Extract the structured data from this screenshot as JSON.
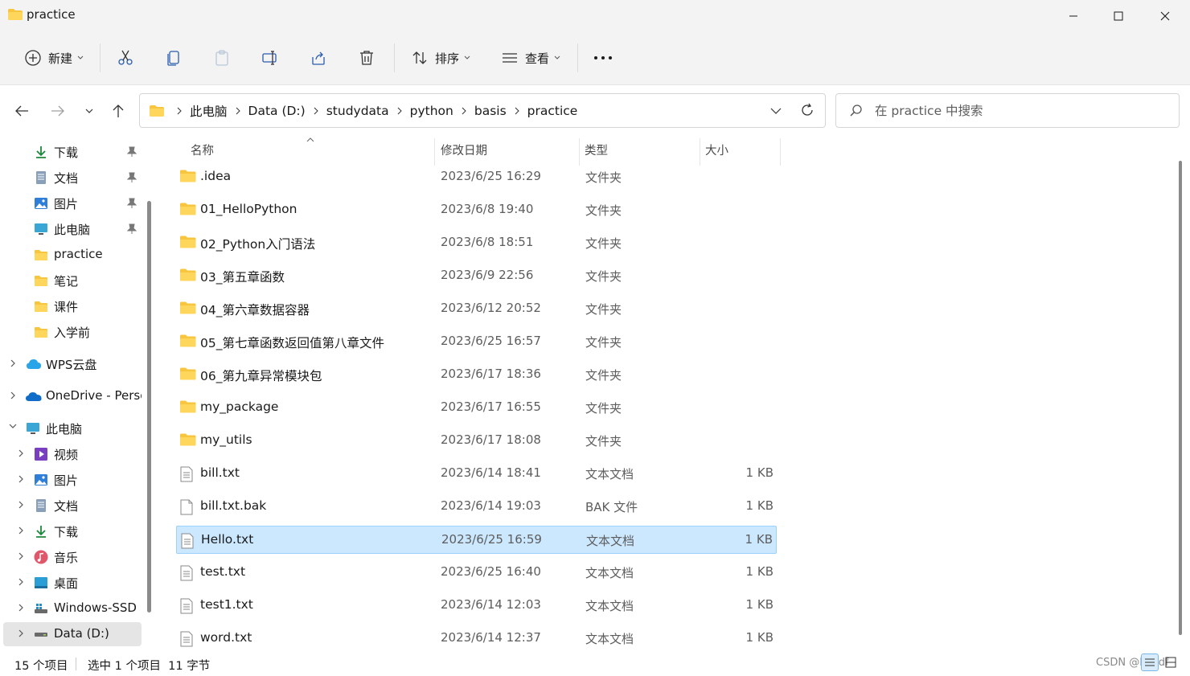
{
  "window": {
    "title": "practice"
  },
  "toolbar": {
    "new_label": "新建",
    "sort_label": "排序",
    "view_label": "查看"
  },
  "breadcrumb": [
    "此电脑",
    "Data (D:)",
    "studydata",
    "python",
    "basis",
    "practice"
  ],
  "search": {
    "placeholder": "在 practice 中搜索"
  },
  "sidebar": {
    "quick": [
      {
        "label": "下载",
        "icon": "download-icon",
        "pinned": true
      },
      {
        "label": "文档",
        "icon": "document-icon",
        "pinned": true
      },
      {
        "label": "图片",
        "icon": "picture-icon",
        "pinned": true
      },
      {
        "label": "此电脑",
        "icon": "computer-icon",
        "pinned": true
      },
      {
        "label": "practice",
        "icon": "folder-icon",
        "pinned": false
      },
      {
        "label": "笔记",
        "icon": "folder-icon",
        "pinned": false
      },
      {
        "label": "课件",
        "icon": "folder-icon",
        "pinned": false
      },
      {
        "label": "入学前",
        "icon": "folder-icon",
        "pinned": false
      }
    ],
    "roots": [
      {
        "label": "WPS云盘",
        "icon": "cloud-icon"
      },
      {
        "label": "OneDrive - Personal",
        "icon": "onedrive-icon"
      },
      {
        "label": "此电脑",
        "icon": "computer-icon"
      }
    ],
    "pc_children": [
      {
        "label": "视频",
        "icon": "video-icon"
      },
      {
        "label": "图片",
        "icon": "picture-icon"
      },
      {
        "label": "文档",
        "icon": "document-icon"
      },
      {
        "label": "下载",
        "icon": "download-icon"
      },
      {
        "label": "音乐",
        "icon": "music-icon"
      },
      {
        "label": "桌面",
        "icon": "desktop-icon"
      },
      {
        "label": "Windows-SSD (C:)",
        "icon": "drive-icon"
      },
      {
        "label": "Data (D:)",
        "icon": "drive-icon"
      }
    ]
  },
  "columns": {
    "name": "名称",
    "date": "修改日期",
    "type": "类型",
    "size": "大小"
  },
  "files": [
    {
      "name": ".idea",
      "date": "2023/6/25 16:29",
      "type": "文件夹",
      "size": "",
      "kind": "folder"
    },
    {
      "name": "01_HelloPython",
      "date": "2023/6/8 19:40",
      "type": "文件夹",
      "size": "",
      "kind": "folder"
    },
    {
      "name": "02_Python入门语法",
      "date": "2023/6/8 18:51",
      "type": "文件夹",
      "size": "",
      "kind": "folder"
    },
    {
      "name": "03_第五章函数",
      "date": "2023/6/9 22:56",
      "type": "文件夹",
      "size": "",
      "kind": "folder"
    },
    {
      "name": "04_第六章数据容器",
      "date": "2023/6/12 20:52",
      "type": "文件夹",
      "size": "",
      "kind": "folder"
    },
    {
      "name": "05_第七章函数返回值第八章文件",
      "date": "2023/6/25 16:57",
      "type": "文件夹",
      "size": "",
      "kind": "folder"
    },
    {
      "name": "06_第九章异常模块包",
      "date": "2023/6/17 18:36",
      "type": "文件夹",
      "size": "",
      "kind": "folder"
    },
    {
      "name": "my_package",
      "date": "2023/6/17 16:55",
      "type": "文件夹",
      "size": "",
      "kind": "folder"
    },
    {
      "name": "my_utils",
      "date": "2023/6/17 18:08",
      "type": "文件夹",
      "size": "",
      "kind": "folder"
    },
    {
      "name": "bill.txt",
      "date": "2023/6/14 18:41",
      "type": "文本文档",
      "size": "1 KB",
      "kind": "text"
    },
    {
      "name": "bill.txt.bak",
      "date": "2023/6/14 19:03",
      "type": "BAK 文件",
      "size": "1 KB",
      "kind": "blank"
    },
    {
      "name": "Hello.txt",
      "date": "2023/6/25 16:59",
      "type": "文本文档",
      "size": "1 KB",
      "kind": "text",
      "selected": true
    },
    {
      "name": "test.txt",
      "date": "2023/6/25 16:40",
      "type": "文本文档",
      "size": "1 KB",
      "kind": "text"
    },
    {
      "name": "test1.txt",
      "date": "2023/6/14 12:03",
      "type": "文本文档",
      "size": "1 KB",
      "kind": "text"
    },
    {
      "name": "word.txt",
      "date": "2023/6/14 12:37",
      "type": "文本文档",
      "size": "1 KB",
      "kind": "text"
    }
  ],
  "status": {
    "count": "15 个项目",
    "selection": "选中 1 个项目  11 字节",
    "watermark": "CSDN @Hi_ldf"
  },
  "colors": {
    "folder": "#f8c53f",
    "selection": "#cce8ff",
    "accent": "#0067c0"
  }
}
